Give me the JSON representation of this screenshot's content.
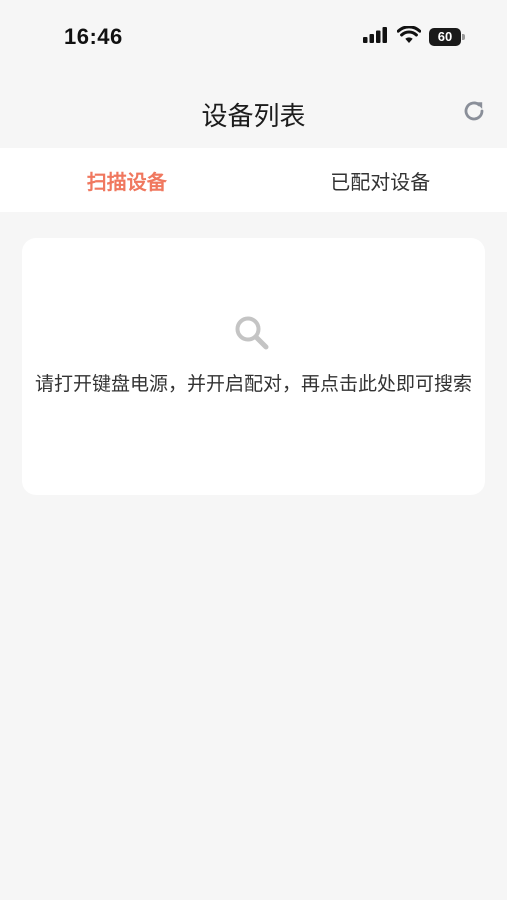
{
  "status_bar": {
    "time": "16:46",
    "battery_level": "60",
    "icons": [
      "signal-icon",
      "wifi-icon",
      "battery-icon"
    ]
  },
  "header": {
    "title": "设备列表",
    "refresh_icon": "refresh-icon"
  },
  "tabs": [
    {
      "label": "扫描设备",
      "active": true
    },
    {
      "label": "已配对设备",
      "active": false
    }
  ],
  "empty_state": {
    "icon": "search-icon",
    "message": "请打开键盘电源，并开启配对，再点击此处即可搜索"
  },
  "colors": {
    "accent": "#f0785f",
    "background": "#f6f6f6",
    "card": "#ffffff",
    "icon_gray": "#c4c4c4"
  }
}
